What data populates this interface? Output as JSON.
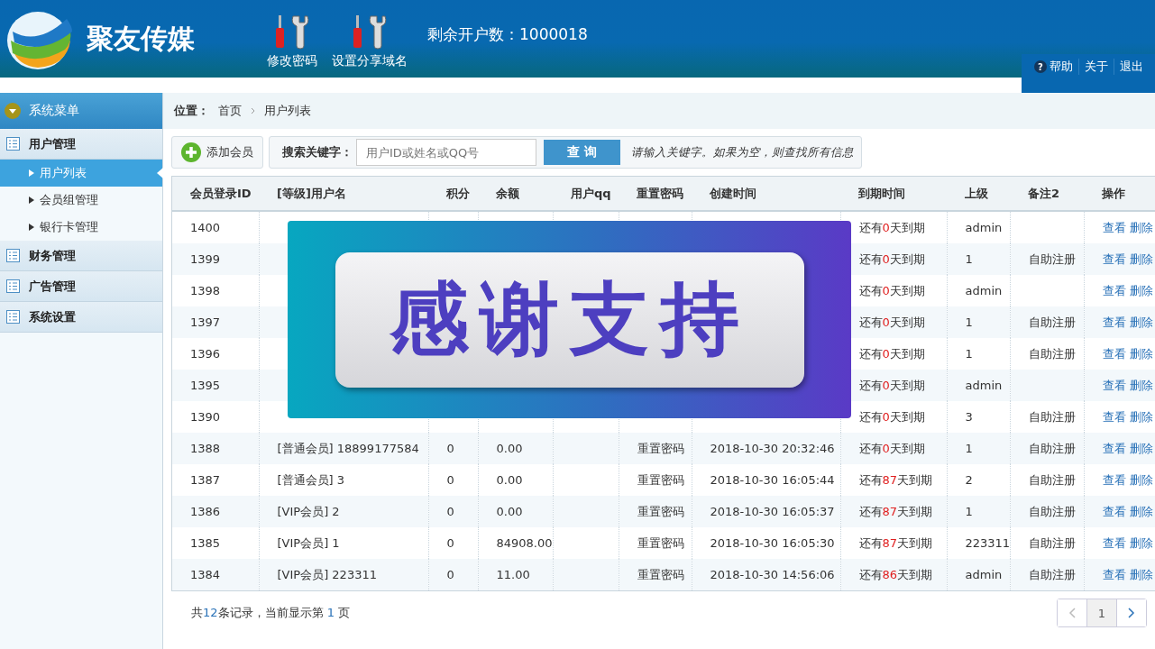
{
  "header": {
    "brand": "聚友传媒",
    "tools": [
      {
        "label": "修改密码"
      },
      {
        "label": "设置分享域名"
      }
    ],
    "account_count": "剩余开户数：1000018",
    "links": [
      {
        "label": "帮助",
        "kind": "help",
        "icon": "?"
      },
      {
        "label": "关于",
        "kind": "plain"
      },
      {
        "label": "退出",
        "kind": "plain"
      }
    ]
  },
  "sidebar": {
    "title": "系统菜单",
    "groups": [
      {
        "label": "用户管理",
        "children": [
          {
            "label": "用户列表",
            "selected": true
          },
          {
            "label": "会员组管理",
            "selected": false
          },
          {
            "label": "银行卡管理",
            "selected": false
          }
        ]
      },
      {
        "label": "财务管理"
      },
      {
        "label": "广告管理"
      },
      {
        "label": "系统设置"
      }
    ]
  },
  "breadcrumb": {
    "label": "位置：",
    "items": [
      "首页",
      "用户列表"
    ]
  },
  "toolbar": {
    "add_button": "添加会员",
    "search_label": "搜索关键字：",
    "search_placeholder": "用户ID或姓名或QQ号",
    "search_button": "查 询",
    "hint": "请输入关键字。如果为空，则查找所有信息"
  },
  "table": {
    "columns": [
      "会员登录ID",
      "[等级]用户名",
      "积分",
      "余额",
      "用户qq",
      "重置密码",
      "创建时间",
      "到期时间",
      "上级",
      "备注2",
      "操作"
    ],
    "rows": [
      {
        "id": "1400",
        "expiry": {
          "before": "还有",
          "days": "0",
          "after": "天到期"
        },
        "parent": "admin",
        "actions": [
          "查看",
          "删除"
        ]
      },
      {
        "id": "1399",
        "expiry": {
          "before": "还有",
          "days": "0",
          "after": "天到期"
        },
        "parent": "1",
        "note": "自助注册",
        "actions": [
          "查看",
          "删除"
        ]
      },
      {
        "id": "1398",
        "expiry": {
          "before": "还有",
          "days": "0",
          "after": "天到期"
        },
        "parent": "admin",
        "actions": [
          "查看",
          "删除"
        ]
      },
      {
        "id": "1397",
        "expiry": {
          "before": "还有",
          "days": "0",
          "after": "天到期"
        },
        "parent": "1",
        "note": "自助注册",
        "actions": [
          "查看",
          "删除"
        ]
      },
      {
        "id": "1396",
        "expiry": {
          "before": "还有",
          "days": "0",
          "after": "天到期"
        },
        "parent": "1",
        "note": "自助注册",
        "actions": [
          "查看",
          "删除"
        ]
      },
      {
        "id": "1395",
        "expiry": {
          "before": "还有",
          "days": "0",
          "after": "天到期"
        },
        "parent": "admin",
        "actions": [
          "查看",
          "删除"
        ]
      },
      {
        "id": "1390",
        "expiry": {
          "before": "还有",
          "days": "0",
          "after": "天到期"
        },
        "parent": "3",
        "note": "自助注册",
        "actions": [
          "查看",
          "删除"
        ]
      },
      {
        "id": "1388",
        "user": "[普通会员] 18899177584",
        "points": "0",
        "balance": "0.00",
        "reset": "重置密码",
        "created": "2018-10-30 20:32:46",
        "expiry": {
          "before": "还有",
          "days": "0",
          "after": "天到期"
        },
        "parent": "1",
        "note": "自助注册",
        "actions": [
          "查看",
          "删除"
        ]
      },
      {
        "id": "1387",
        "user": "[普通会员] 3",
        "points": "0",
        "balance": "0.00",
        "reset": "重置密码",
        "created": "2018-10-30 16:05:44",
        "expiry": {
          "before": "还有",
          "days": "87",
          "after": "天到期"
        },
        "parent": "2",
        "note": "自助注册",
        "actions": [
          "查看",
          "删除"
        ]
      },
      {
        "id": "1386",
        "user": "[VIP会员] 2",
        "points": "0",
        "balance": "0.00",
        "reset": "重置密码",
        "created": "2018-10-30 16:05:37",
        "expiry": {
          "before": "还有",
          "days": "87",
          "after": "天到期"
        },
        "parent": "1",
        "note": "自助注册",
        "actions": [
          "查看",
          "删除"
        ]
      },
      {
        "id": "1385",
        "user": "[VIP会员] 1",
        "points": "0",
        "balance": "84908.00",
        "reset": "重置密码",
        "created": "2018-10-30 16:05:30",
        "expiry": {
          "before": "还有",
          "days": "87",
          "after": "天到期"
        },
        "parent": "223311",
        "note": "自助注册",
        "actions": [
          "查看",
          "删除"
        ]
      },
      {
        "id": "1384",
        "user": "[VIP会员] 223311",
        "points": "0",
        "balance": "11.00",
        "reset": "重置密码",
        "created": "2018-10-30 14:56:06",
        "expiry": {
          "before": "还有",
          "days": "86",
          "after": "天到期"
        },
        "parent": "admin",
        "note": "自助注册",
        "actions": [
          "查看",
          "删除"
        ]
      }
    ]
  },
  "overlay_banner": {
    "text": "感谢支持"
  },
  "footer": {
    "summary": [
      "共",
      "12",
      "条记录，当前显示第 ",
      "1",
      " 页"
    ],
    "pages": [
      {
        "label": "1",
        "selected": true
      }
    ]
  }
}
